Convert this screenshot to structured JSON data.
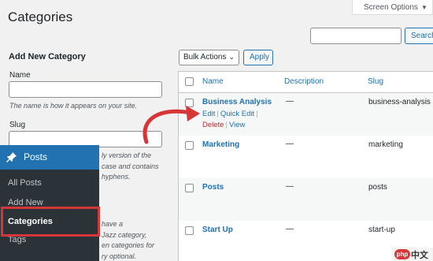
{
  "header": {
    "title": "Categories",
    "screen_options": "Screen Options",
    "screen_options_arrow": "▼",
    "search_button": "Search"
  },
  "form": {
    "title": "Add New Category",
    "name_label": "Name",
    "name_hint": "The name is how it appears on your site.",
    "slug_label": "Slug",
    "slug_hint_lines": [
      "ly version of the",
      "case and contains",
      "hyphens."
    ],
    "desc_hint_lines": [
      "have a",
      "Jazz category,",
      "en categories for",
      "ry optional."
    ]
  },
  "toolbar": {
    "bulk_actions": "Bulk Actions",
    "bulk_caret": "⌄",
    "apply": "Apply"
  },
  "table": {
    "columns": [
      "Name",
      "Description",
      "Slug"
    ],
    "rows": [
      {
        "name": "Business Analysis",
        "description": "—",
        "slug": "business-analysis"
      },
      {
        "name": "Marketing",
        "description": "—",
        "slug": "marketing"
      },
      {
        "name": "Posts",
        "description": "—",
        "slug": "posts"
      },
      {
        "name": "Start Up",
        "description": "—",
        "slug": "start-up"
      }
    ],
    "row_actions": {
      "edit": "Edit",
      "quick_edit": "Quick Edit",
      "delete": "Delete",
      "view": "View",
      "separator": "|"
    }
  },
  "sidebar": {
    "section": "Posts",
    "items": [
      "All Posts",
      "Add New",
      "Categories",
      "Tags"
    ],
    "current": "Categories"
  },
  "watermark": {
    "logo_text": "php",
    "site": "中文网"
  },
  "colors": {
    "accent": "#2271b1",
    "highlight": "#d63638",
    "menu_bg": "#2c3338"
  }
}
